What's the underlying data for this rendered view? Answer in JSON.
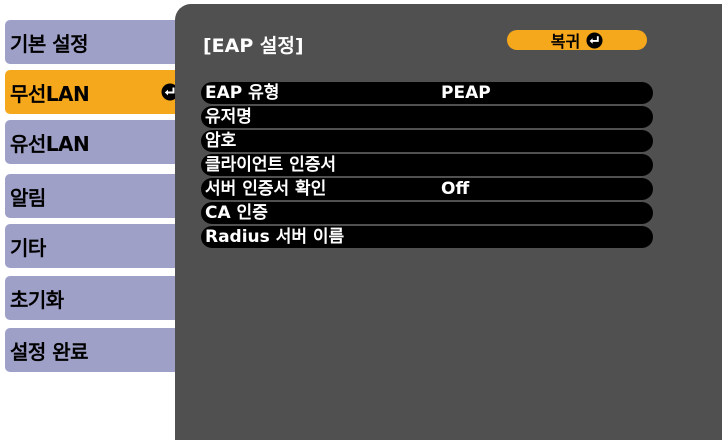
{
  "menu": {
    "items": [
      {
        "label": "기본 설정",
        "selected": false
      },
      {
        "label": "무선LAN",
        "selected": true
      },
      {
        "label": "유선LAN",
        "selected": false
      },
      {
        "label": "알림",
        "selected": false
      },
      {
        "label": "기타",
        "selected": false
      },
      {
        "label": "초기화",
        "selected": false
      },
      {
        "label": "설정 완료",
        "selected": false
      }
    ]
  },
  "panel": {
    "title": "[EAP 설정]",
    "back_label": "복귀",
    "rows": [
      {
        "label": "EAP 유형",
        "value": "PEAP"
      },
      {
        "label": "유저명",
        "value": ""
      },
      {
        "label": "암호",
        "value": ""
      },
      {
        "label": "클라이언트 인증서",
        "value": ""
      },
      {
        "label": "서버 인증서 확인",
        "value": "Off"
      },
      {
        "label": "CA 인증",
        "value": ""
      },
      {
        "label": "Radius 서버 이름",
        "value": ""
      }
    ]
  },
  "colors": {
    "menu_item": "#9fa0c8",
    "accent": "#f6a81c",
    "panel": "#505050",
    "row": "#000000"
  },
  "icons": {
    "enter": "enter-icon"
  }
}
